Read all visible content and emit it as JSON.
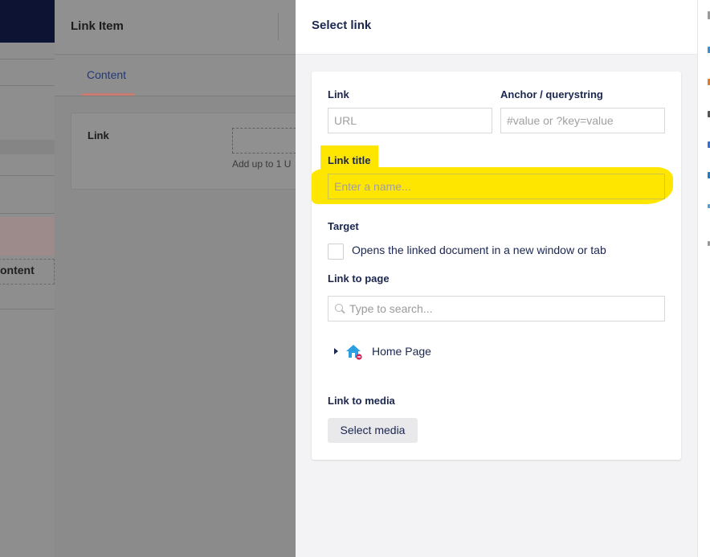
{
  "background": {
    "partial_text": "ontent"
  },
  "link_item_panel": {
    "title": "Link Item",
    "tabs": [
      {
        "label": "Content"
      }
    ],
    "link_field_label": "Link",
    "add_hint": "Add up to 1 U"
  },
  "dialog": {
    "title": "Select link",
    "link": {
      "label": "Link",
      "placeholder": "URL"
    },
    "anchor": {
      "label": "Anchor / querystring",
      "placeholder": "#value or ?key=value"
    },
    "link_title": {
      "label": "Link title",
      "placeholder": "Enter a name..."
    },
    "target": {
      "label": "Target",
      "checkbox_label": "Opens the linked document in a new window or tab",
      "checked": false
    },
    "link_to_page": {
      "label": "Link to page",
      "search_placeholder": "Type to search..."
    },
    "tree": [
      {
        "label": "Home Page",
        "icon": "home-icon"
      }
    ],
    "link_to_media": {
      "label": "Link to media",
      "button": "Select media"
    }
  },
  "colors": {
    "highlight": "#ffe600",
    "accent_text": "#1b264f",
    "tab_underline": "#c87c70"
  }
}
